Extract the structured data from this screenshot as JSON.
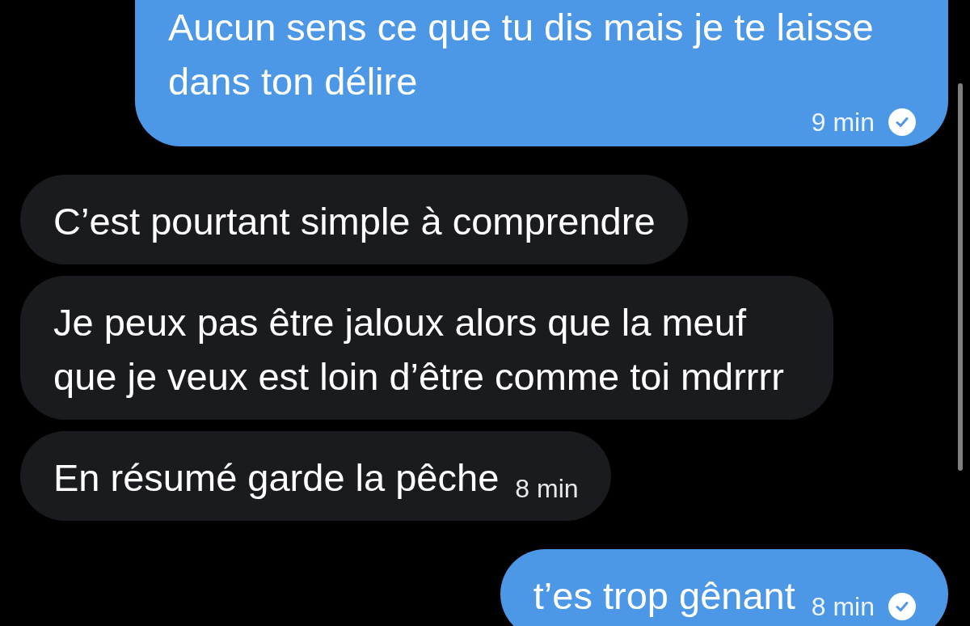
{
  "messages": [
    {
      "kind": "sent",
      "text": "Aucun sens ce que tu dis mais je te laisse dans ton délire",
      "time": "9 min",
      "seen": true
    },
    {
      "kind": "received",
      "text": "C’est pourtant simple à comprendre",
      "seen": false
    },
    {
      "kind": "received",
      "text": "Je peux pas être jaloux alors que la meuf que je veux est loin d’être comme toi mdrrrr",
      "seen": false
    },
    {
      "kind": "received",
      "text": "En résumé garde la pêche",
      "time": "8 min",
      "seen": false
    },
    {
      "kind": "sent",
      "text": "t’es trop gênant",
      "time": "8 min",
      "seen": true
    }
  ]
}
